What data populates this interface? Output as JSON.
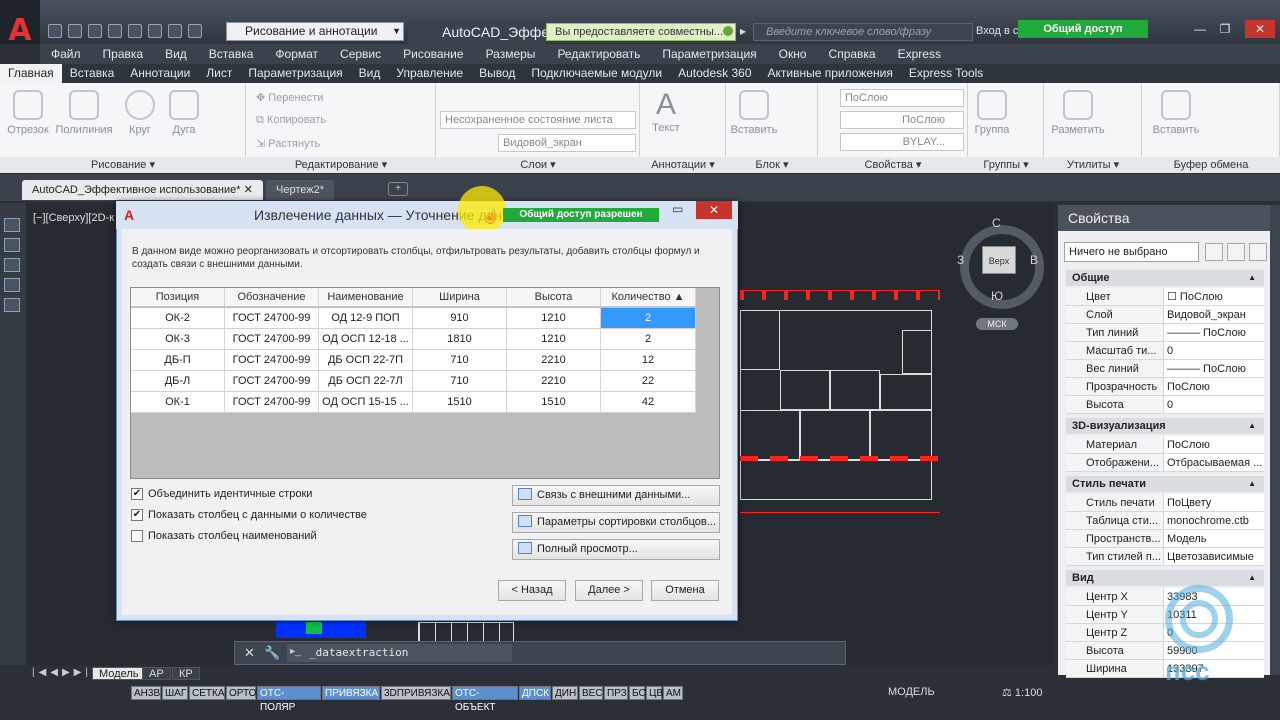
{
  "app": {
    "window_title": "AutoCAD_Эффе",
    "workspace": "Рисование и аннотации",
    "share_message": "Вы предоставляете совместны...",
    "search_placeholder": "Введите ключевое слово/фразу",
    "login": "Вход в с",
    "share_badge": "Общий доступ разрешен"
  },
  "menubar": [
    "Файл",
    "Правка",
    "Вид",
    "Вставка",
    "Формат",
    "Сервис",
    "Рисование",
    "Размеры",
    "Редактировать",
    "Параметризация",
    "Окно",
    "Справка",
    "Express"
  ],
  "ribbon_tabs": [
    "Главная",
    "Вставка",
    "Аннотации",
    "Лист",
    "Параметризация",
    "Вид",
    "Управление",
    "Вывод",
    "Подключаемые модули",
    "Autodesk 360",
    "Активные приложения",
    "Express Tools"
  ],
  "ribbon": {
    "draw": {
      "title": "Рисование ▾",
      "tools": [
        "Отрезок",
        "Полилиния",
        "Круг",
        "Дуга"
      ]
    },
    "modify": {
      "title": "Редактирование ▾",
      "tools": [
        "Перенести",
        "Копировать",
        "Растянуть"
      ]
    },
    "layers": {
      "title": "Слои ▾",
      "state": "Несохраненное состояние листа",
      "layer": "Видовой_экран"
    },
    "annotations": {
      "title": "Аннотации ▾",
      "text": "Текст"
    },
    "block": {
      "title": "Блок ▾",
      "insert": "Вставить"
    },
    "properties": {
      "title": "Свойства ▾",
      "color": "ПоСлою",
      "linetype": "ПоСлою",
      "lineweight": "BYLAY..."
    },
    "groups": {
      "title": "Группы ▾",
      "group": "Группа"
    },
    "utilities": {
      "title": "Утилиты ▾",
      "measure": "Разметить"
    },
    "clipboard": {
      "title": "Буфер обмена",
      "paste": "Вставить"
    }
  },
  "doc_tabs": [
    "AutoCAD_Эффективное использование*",
    "Чертеж2*"
  ],
  "viewport_label": "[−][Сверху][2D-к",
  "viewcube": {
    "n": "С",
    "s": "Ю",
    "w": "З",
    "e": "В",
    "top": "Верх",
    "ucs": "МСК"
  },
  "properties": {
    "title": "Свойства",
    "selection": "Ничего не выбрано",
    "sections": [
      {
        "name": "Общие",
        "rows": [
          [
            "Цвет",
            "☐ ПоСлою"
          ],
          [
            "Слой",
            "Видовой_экран"
          ],
          [
            "Тип линий",
            "——— ПоСлою"
          ],
          [
            "Масштаб ти...",
            "0"
          ],
          [
            "Вес линий",
            "——— ПоСлою"
          ],
          [
            "Прозрачность",
            "ПоСлою"
          ],
          [
            "Высота",
            "0"
          ]
        ]
      },
      {
        "name": "3D-визуализация",
        "rows": [
          [
            "Материал",
            "ПоСлою"
          ],
          [
            "Отображени...",
            "Отбрасываемая ..."
          ]
        ]
      },
      {
        "name": "Стиль печати",
        "rows": [
          [
            "Стиль печати",
            "ПоЦвету"
          ],
          [
            "Таблица сти...",
            "monochrome.ctb"
          ],
          [
            "Пространств...",
            "Модель"
          ],
          [
            "Тип стилей п...",
            "Цветозависимые"
          ]
        ]
      },
      {
        "name": "Вид",
        "rows": [
          [
            "Центр X",
            "33983"
          ],
          [
            "Центр Y",
            "10311"
          ],
          [
            "Центр Z",
            "0"
          ],
          [
            "Высота",
            "59900"
          ],
          [
            "Ширина",
            "133397"
          ]
        ]
      }
    ]
  },
  "dialog": {
    "title": "Извлечение данных — Уточнение дан",
    "share_badge": "Общий доступ разрешен",
    "description": "В данном виде можно реорганизовать и отсортировать столбцы, отфильтровать результаты, добавить столбцы формул и создать связи с внешними данными.",
    "columns": [
      "Позиция",
      "Обозначение",
      "Наименование",
      "Ширина",
      "Высота",
      "Количество ▲"
    ],
    "rows": [
      [
        "ОК-2",
        "ГОСТ 24700-99",
        "ОД 12-9 ПОП",
        "910",
        "1210",
        "2"
      ],
      [
        "ОК-3",
        "ГОСТ 24700-99",
        "ОД ОСП 12-18 ...",
        "1810",
        "1210",
        "2"
      ],
      [
        "ДБ-П",
        "ГОСТ 24700-99",
        "ДБ ОСП 22-7П",
        "710",
        "2210",
        "12"
      ],
      [
        "ДБ-Л",
        "ГОСТ 24700-99",
        "ДБ ОСП 22-7Л",
        "710",
        "2210",
        "22"
      ],
      [
        "ОК-1",
        "ГОСТ 24700-99",
        "ОД ОСП 15-15 ...",
        "1510",
        "1510",
        "42"
      ]
    ],
    "checkboxes": [
      {
        "label": "Объединить идентичные строки",
        "checked": "✔"
      },
      {
        "label": "Показать столбец с данными о количестве",
        "checked": "✔"
      },
      {
        "label": "Показать столбец наименований",
        "checked": ""
      }
    ],
    "side_buttons": [
      "Связь с внешними данными...",
      "Параметры сортировки столбцов...",
      "Полный просмотр..."
    ],
    "buttons": {
      "back": "< Назад",
      "next": "Далее >",
      "cancel": "Отмена"
    }
  },
  "layout_tabs": [
    "Модель",
    "АР",
    "КР"
  ],
  "command": "_dataextraction",
  "status_toggles": [
    "АН3В",
    "ШАГ",
    "СЕТКА",
    "ОРТО",
    "ОТС-ПОЛЯР",
    "ПРИВЯЗКА",
    "3DПРИВЯЗКА",
    "ОТС-ОБЪЕКТ",
    "ДПСК",
    "ДИН",
    "ВЕС",
    "ПРЗ",
    "БС",
    "ЦВ",
    "АМ"
  ],
  "status_right": {
    "space": "МОДЕЛЬ",
    "scale": "1:100"
  },
  "watermark": "псс",
  "colors": {
    "accent": "#3399ff",
    "share": "#1faa3a",
    "close": "#c7342d"
  }
}
